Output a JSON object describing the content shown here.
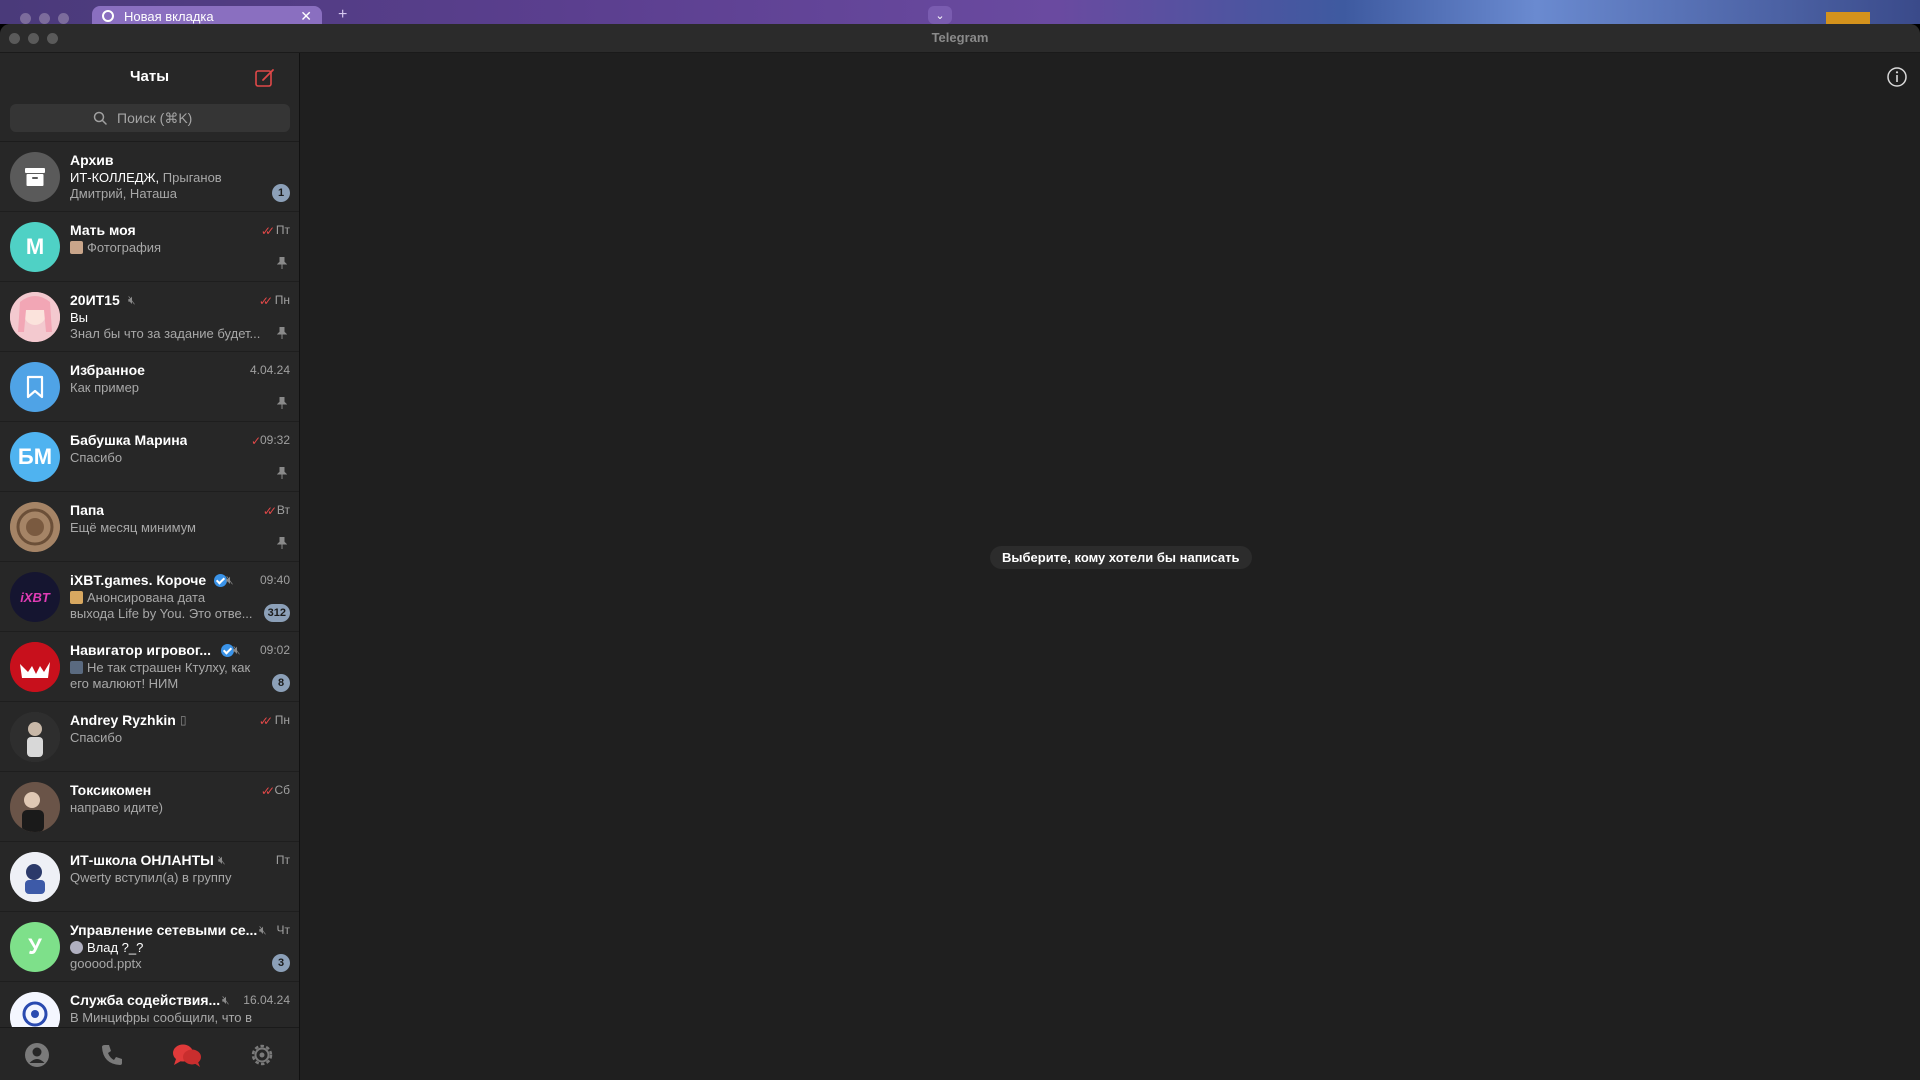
{
  "browser": {
    "tab_title": "Новая вкладка",
    "tab_close": "✕",
    "new_tab": "+",
    "dropdown": "⌄"
  },
  "app": {
    "window_title": "Telegram"
  },
  "sidebar": {
    "title": "Чаты",
    "search_placeholder": "Поиск (⌘K)"
  },
  "chats": [
    {
      "name": "Архив",
      "line1_bold": "ИТ-КОЛЛЕДЖ,",
      "line1": " Прыганов",
      "line2": "Дмитрий, Наташа",
      "time": "",
      "badge": "1",
      "avatar_color": "#5a5a5a",
      "avatar_text": ""
    },
    {
      "name": "Мать моя",
      "line1_bold": "",
      "line1": "Фотография",
      "line2": "",
      "time": "Пт",
      "check": "✓✓",
      "pinned": true,
      "avatar_color": "#4fd1c5",
      "avatar_text": "М"
    },
    {
      "name": "20ИТ15",
      "line1_bold": "Вы",
      "line1": "",
      "line2": "Знал бы что за задание будет...",
      "time": "Пн",
      "check": "✓✓",
      "pinned": true,
      "avatar_color": "#f0b7c0",
      "avatar_text": ""
    },
    {
      "name": "Избранное",
      "line1_bold": "",
      "line1": "Как пример",
      "line2": "",
      "time": "4.04.24",
      "pinned": true,
      "avatar_color": "#4fa3e6",
      "avatar_text": ""
    },
    {
      "name": "Бабушка Марина",
      "line1_bold": "",
      "line1": "Спасибо",
      "line2": "",
      "time": "09:32",
      "check": "✓",
      "pinned": true,
      "avatar_color": "#4fb3f0",
      "avatar_text": "БМ"
    },
    {
      "name": "Папа",
      "line1_bold": "",
      "line1": "Ещё месяц минимум",
      "line2": "",
      "time": "Вт",
      "check": "✓✓",
      "pinned": true,
      "avatar_color": "#9a7a60",
      "avatar_text": ""
    },
    {
      "name": "iXBT.games. Короче",
      "line1_bold": "",
      "line1": "Анонсирована дата",
      "line2": "выхода Life by You. Это отве...",
      "time": "09:40",
      "badge": "312",
      "verified": true,
      "avatar_color": "#151530",
      "avatar_text": "iXBT"
    },
    {
      "name": "Навигатор игровог...",
      "line1_bold": "",
      "line1": "Не так страшен Ктулху, как",
      "line2": "его малюют!  НИМ",
      "time": "09:02",
      "badge": "8",
      "verified": true,
      "avatar_color": "#d0101c",
      "avatar_text": ""
    },
    {
      "name": "Andrey Ryzhkin",
      "line1_bold": "",
      "line1": "Спасибо",
      "line2": "",
      "time": "Пн",
      "check": "✓✓",
      "avatar_color": "#3a3a3a",
      "avatar_text": ""
    },
    {
      "name": "Токсикомен",
      "line1_bold": "",
      "line1": "направо идите)",
      "line2": "",
      "time": "Сб",
      "check": "✓✓",
      "avatar_color": "#4a3c34",
      "avatar_text": ""
    },
    {
      "name": "ИТ-школа ОНЛАНТЫ",
      "line1_bold": "",
      "line1": "Qwerty вступил(а) в группу",
      "line2": "",
      "time": "Пт",
      "avatar_color": "#e8e8f0",
      "avatar_text": ""
    },
    {
      "name": "Управление сетевыми се...",
      "line1_bold": "Влад ?_?",
      "line1": "",
      "line2": "gooood.pptx",
      "time": "Чт",
      "badge": "3",
      "avatar_color": "#7ee08a",
      "avatar_text": "У"
    },
    {
      "name": "Служба содействия...",
      "line1_bold": "",
      "line1": "В Минцифры сообщили, что в",
      "line2": "",
      "time": "16.04.24",
      "avatar_color": "#f0f4ff",
      "avatar_text": ""
    }
  ],
  "main": {
    "empty_hint": "Выберите, кому хотели бы написать"
  }
}
